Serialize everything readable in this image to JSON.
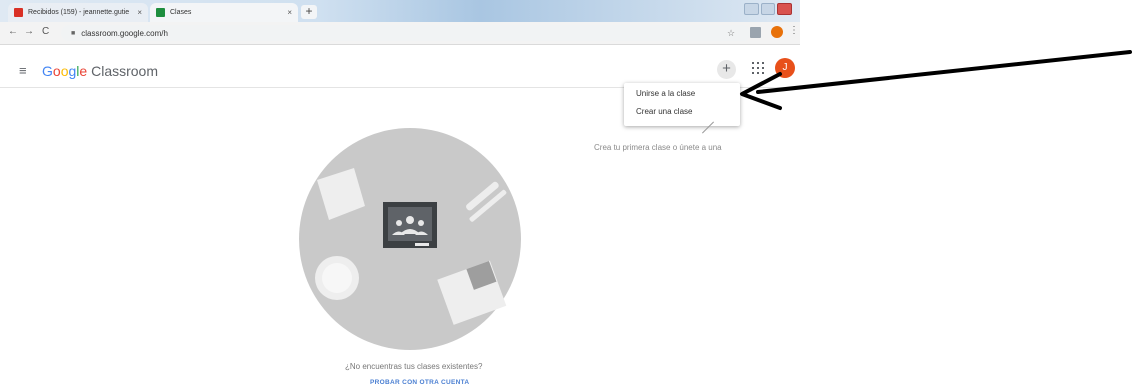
{
  "browser": {
    "tabs": [
      {
        "label": "Recibidos (159) - jeannette.gutie",
        "close": "×",
        "favicon_color": "#d93025"
      },
      {
        "label": "Clases",
        "close": "×",
        "favicon_color": "#1e8e3e"
      }
    ],
    "new_tab": "+",
    "nav": {
      "back": "←",
      "forward": "→",
      "reload": "C"
    },
    "url": "classroom.google.com/h",
    "profile_initial": "J"
  },
  "classroom": {
    "menu_icon": "≡",
    "logo_google": [
      "G",
      "o",
      "o",
      "g",
      "l",
      "e"
    ],
    "logo_product": "Classroom",
    "plus": "+",
    "avatar_initial": "J"
  },
  "dropdown": {
    "items": [
      "Unirse a la clase",
      "Crear una clase"
    ]
  },
  "hint": "Crea tu primera clase o únete a una",
  "empty_state": {
    "question": "¿No encuentras tus clases existentes?",
    "action": "PROBAR CON OTRA CUENTA"
  },
  "colors": {
    "avatar": "#e8501a",
    "illustration_circle": "#c9c9c9",
    "link": "#4a7fd2",
    "annotation_arrow": "#000000"
  }
}
